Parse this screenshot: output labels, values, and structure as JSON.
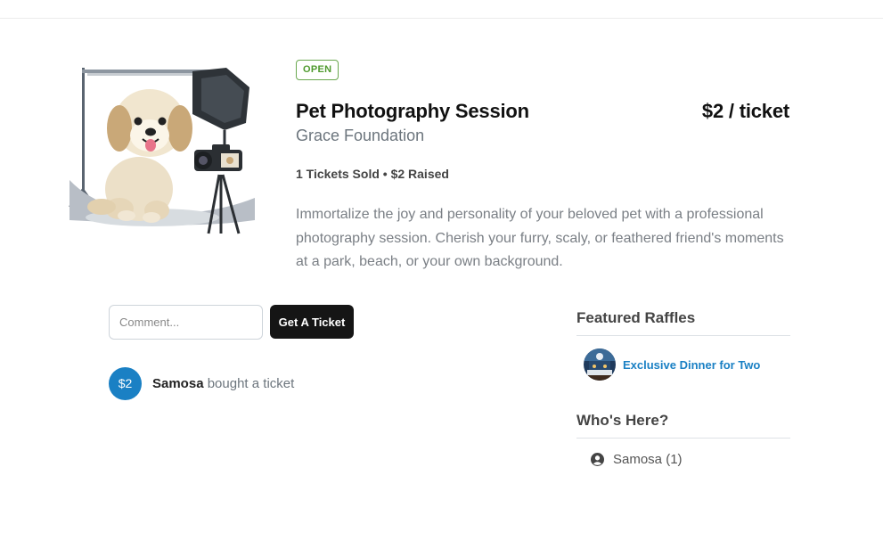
{
  "raffle": {
    "status": "OPEN",
    "title": "Pet Photography Session",
    "price": "$2 / ticket",
    "organization": "Grace Foundation",
    "stats": "1 Tickets Sold • $2 Raised",
    "description": "Immortalize the joy and personality of your beloved pet with a professional photography session. Cherish your furry, scaly, or feathered friend's moments at a park, beach, or your own background.",
    "image_icon": "dog-photoshoot-illustration"
  },
  "actions": {
    "comment_placeholder": "Comment...",
    "get_ticket_label": "Get A Ticket"
  },
  "feed": [
    {
      "avatar": "$2",
      "user": "Samosa",
      "action": " bought a ticket"
    }
  ],
  "sidebar": {
    "featured_heading": "Featured Raffles",
    "featured": [
      {
        "title": "Exclusive Dinner for Two",
        "icon": "dinner-thumbnail"
      }
    ],
    "who_heading": "Who's Here?",
    "who": [
      {
        "label": "Samosa (1)",
        "icon": "user-circle-icon"
      }
    ]
  },
  "colors": {
    "accent": "#1a80c4",
    "open_badge": "#4f9a2e",
    "button": "#151515"
  }
}
